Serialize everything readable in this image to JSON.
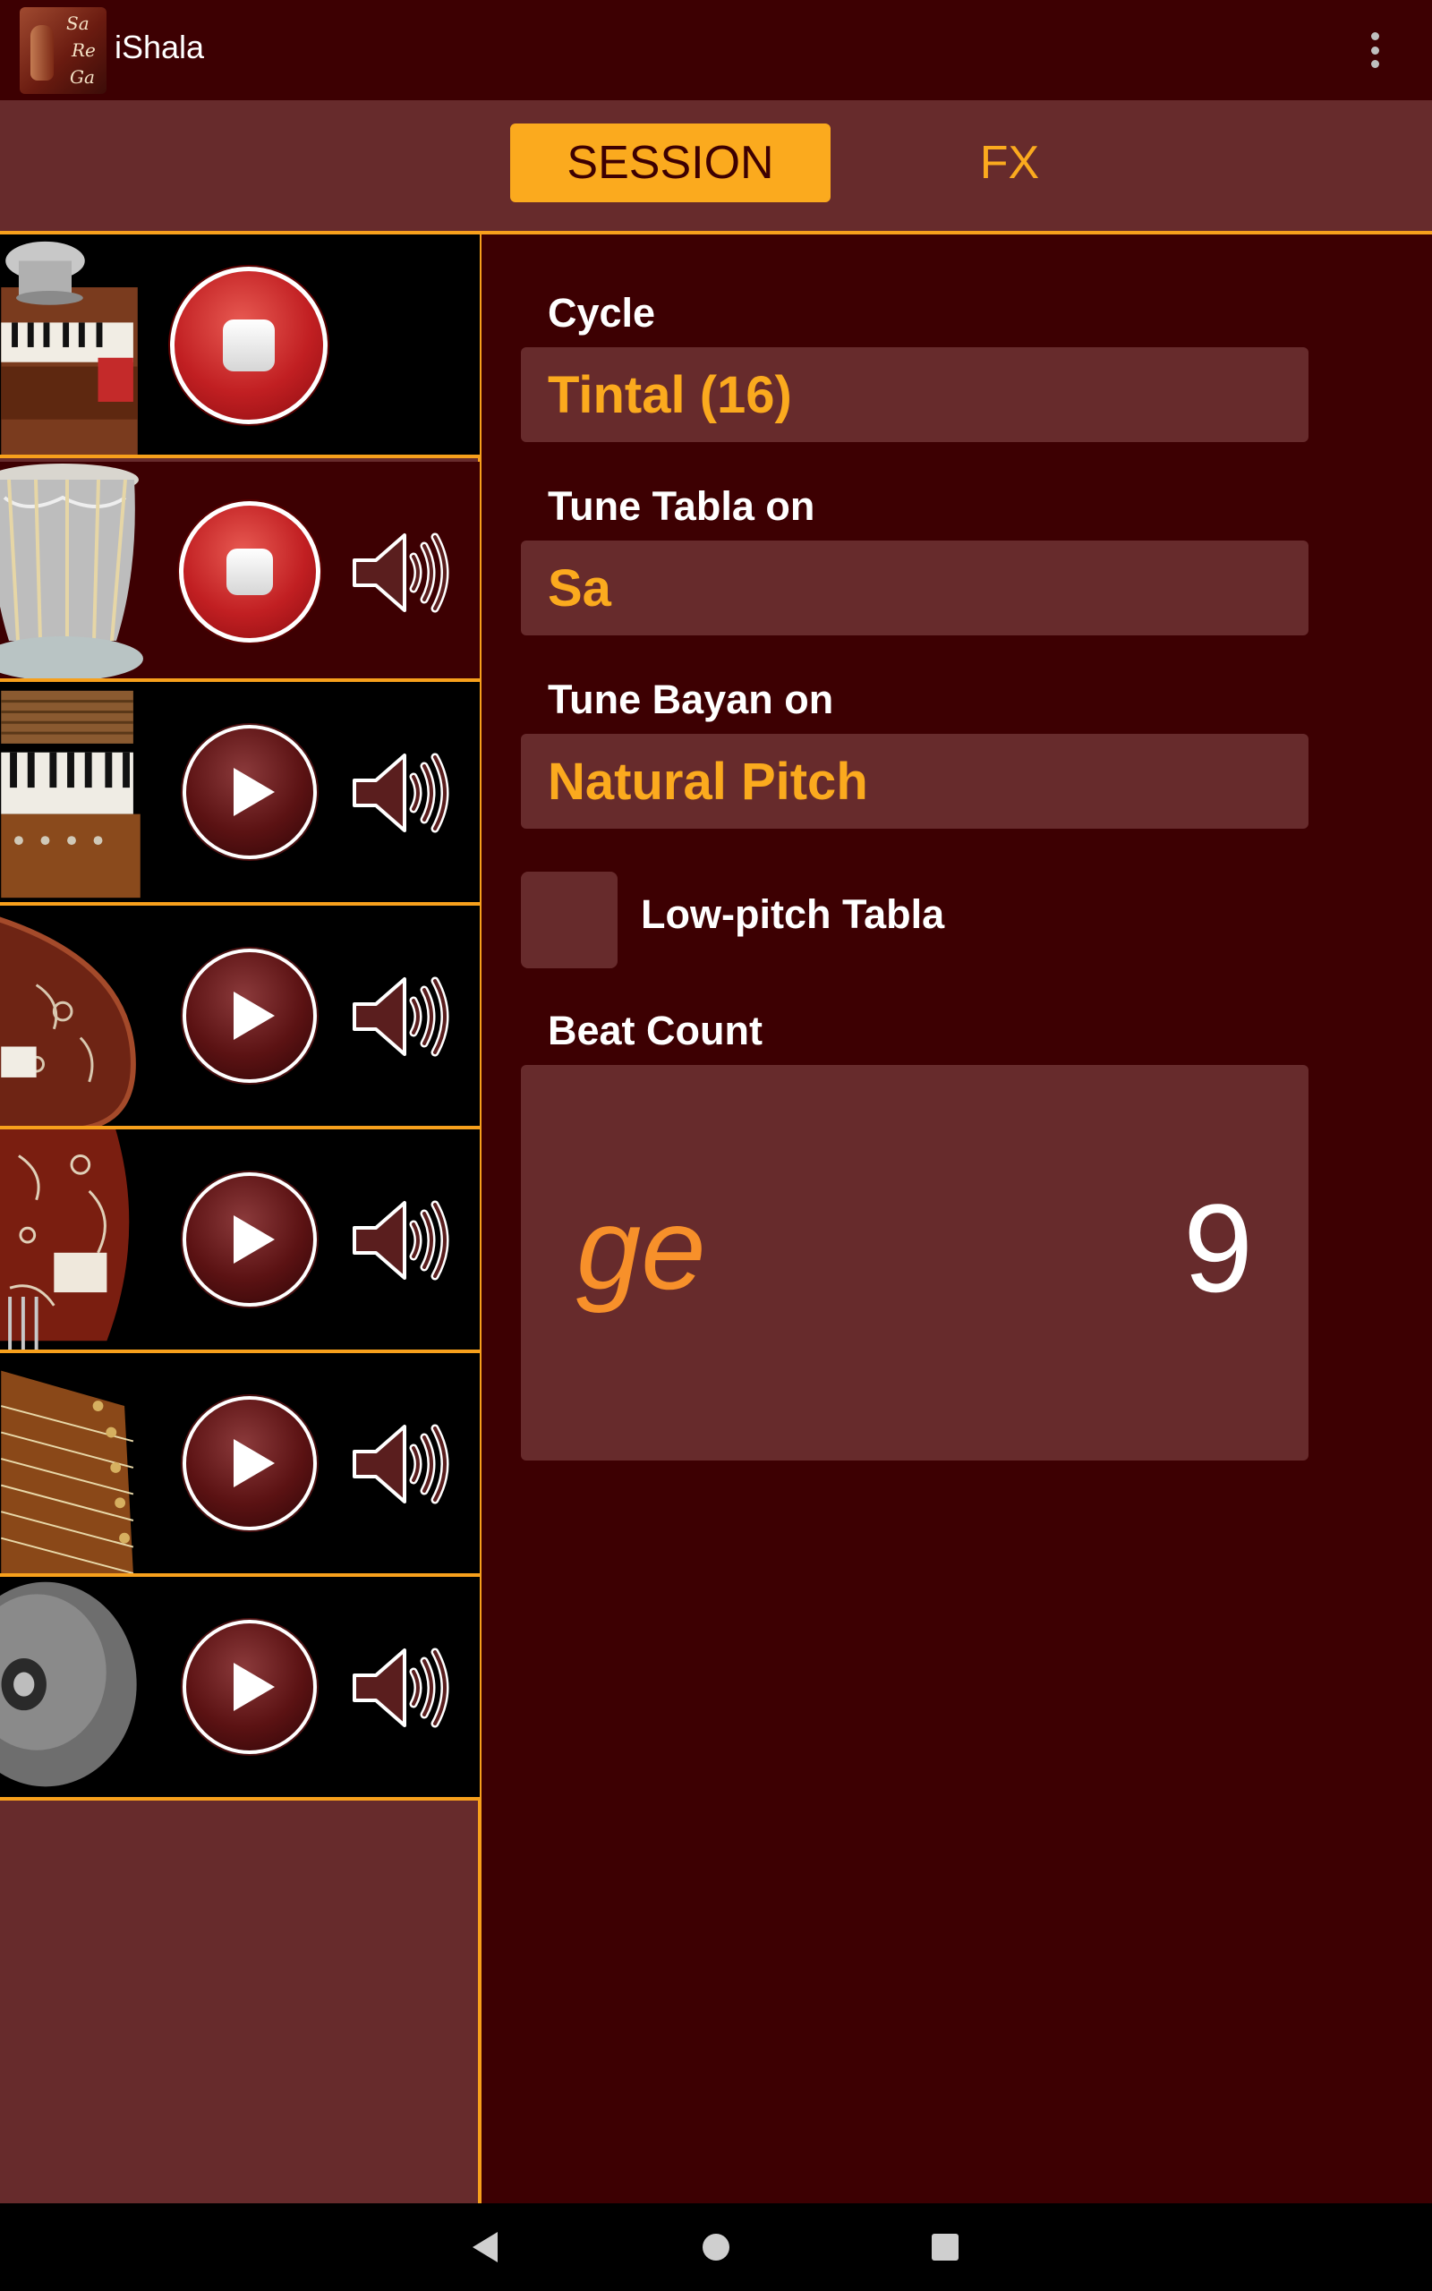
{
  "app": {
    "title": "iShala",
    "logo_letters": [
      "Sa",
      "Re",
      "Ga"
    ]
  },
  "tabs": [
    {
      "label": "SESSION",
      "selected": true
    },
    {
      "label": "FX",
      "selected": false
    }
  ],
  "instruments": [
    {
      "name": "tabla-harmonium",
      "state": "stop",
      "has_volume": false,
      "active": true
    },
    {
      "name": "tabla",
      "state": "stop",
      "has_volume": true,
      "active": true
    },
    {
      "name": "harmonium",
      "state": "play",
      "has_volume": true,
      "active": false
    },
    {
      "name": "tanpura",
      "state": "play",
      "has_volume": true,
      "active": false
    },
    {
      "name": "sitar",
      "state": "play",
      "has_volume": true,
      "active": false
    },
    {
      "name": "swarmandal",
      "state": "play",
      "has_volume": true,
      "active": false
    },
    {
      "name": "manjira",
      "state": "play",
      "has_volume": true,
      "active": false
    }
  ],
  "settings": {
    "cycle_label": "Cycle",
    "cycle_value": "Tintal (16)",
    "tune_tabla_label": "Tune Tabla on",
    "tune_tabla_value": "Sa",
    "tune_bayan_label": "Tune Bayan on",
    "tune_bayan_value": "Natural Pitch",
    "low_pitch_label": "Low-pitch Tabla",
    "low_pitch_checked": false,
    "beat_count_label": "Beat Count",
    "current_bol": "ge",
    "current_beat": "9"
  },
  "colors": {
    "background": "#3d0002",
    "panel": "#672b2c",
    "accent": "#fbaa1e",
    "border": "#f7a01c"
  }
}
